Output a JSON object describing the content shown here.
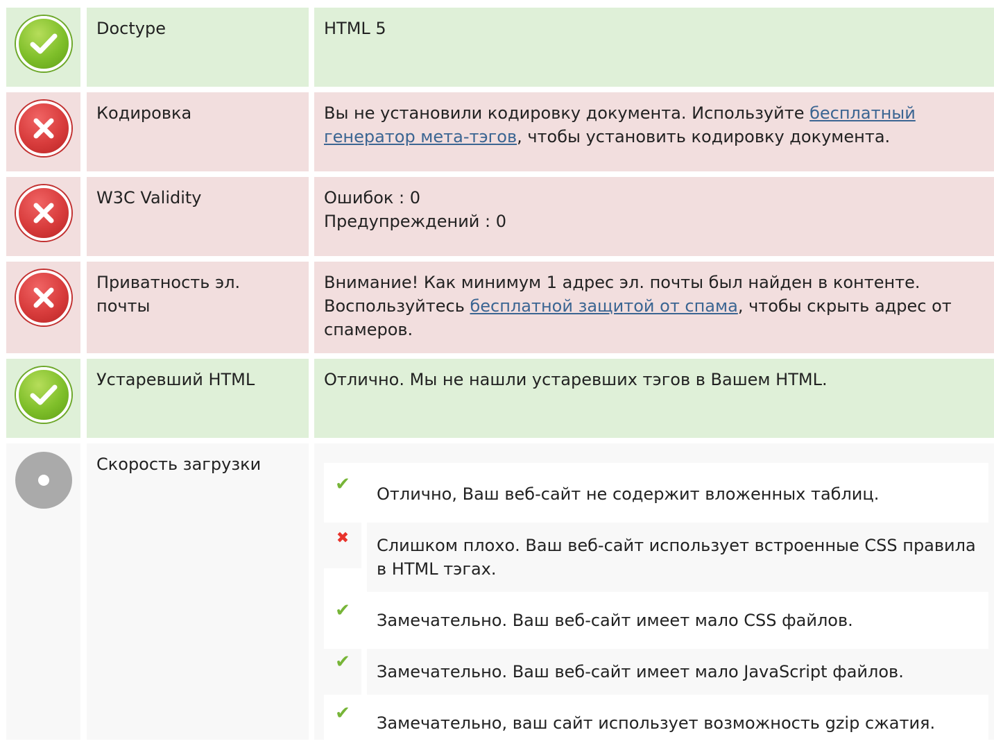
{
  "colors": {
    "ok_bg": "#dff0d8",
    "bad_bg": "#f2dede",
    "neutral_bg": "#f8f8f8",
    "link": "#3b6592",
    "check": "#77b538",
    "cross": "#e8332b"
  },
  "rows": [
    {
      "status": "ok",
      "icon": "check-circle-icon",
      "label": "Doctype",
      "value": "HTML 5"
    },
    {
      "status": "bad",
      "icon": "x-circle-icon",
      "label": "Кодировка",
      "value_before": "Вы не установили кодировку документа. Используйте ",
      "link": "бесплатный генератор мета-тэгов",
      "value_after": ", чтобы установить кодировку документа."
    },
    {
      "status": "bad",
      "icon": "x-circle-icon",
      "label": "W3C Validity",
      "errors": "Ошибок : 0",
      "warnings": "Предупреждений : 0"
    },
    {
      "status": "bad",
      "icon": "x-circle-icon",
      "label": "Приватность эл. почты",
      "value_before": "Внимание! Как минимум 1 адрес эл. почты был найден в контенте. Воспользуйтесь ",
      "link": "бесплатной защитой от спама",
      "value_after": ", чтобы скрыть адрес от спамеров."
    },
    {
      "status": "ok",
      "icon": "check-circle-icon",
      "label": "Устаревший HTML",
      "value": "Отлично. Мы не нашли устаревших тэгов в Вашем HTML."
    },
    {
      "status": "info",
      "icon": "neutral-circle-icon",
      "label": "Скорость загрузки",
      "items": [
        {
          "icon": "check-icon",
          "glyph": "✔",
          "text": "Отлично, Ваш веб-сайт не содержит вложенных таблиц."
        },
        {
          "icon": "cross-icon",
          "glyph": "✖",
          "text": "Слишком плохо. Ваш веб-сайт использует встроенные CSS правила в HTML тэгах."
        },
        {
          "icon": "check-icon",
          "glyph": "✔",
          "text": "Замечательно. Ваш веб-сайт имеет мало CSS файлов."
        },
        {
          "icon": "check-icon",
          "glyph": "✔",
          "text": "Замечательно. Ваш веб-сайт имеет мало JavaScript файлов."
        },
        {
          "icon": "check-icon",
          "glyph": "✔",
          "text": "Замечательно, ваш сайт использует возможность gzip сжатия."
        }
      ]
    }
  ]
}
